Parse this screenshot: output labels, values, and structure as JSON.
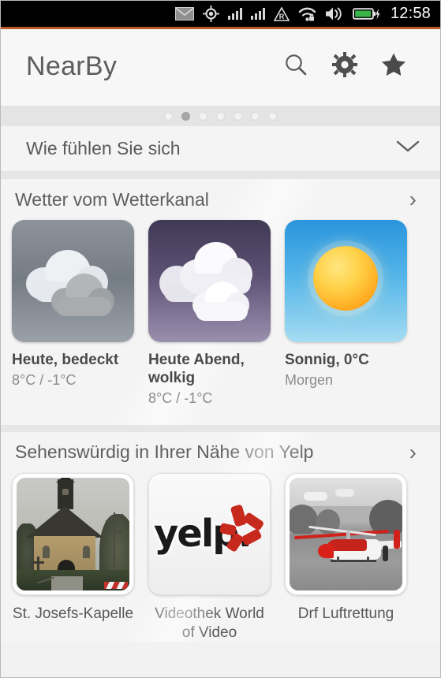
{
  "statusbar": {
    "icons": [
      "mail-icon",
      "location-icon",
      "cellular-signal-icon",
      "cellular-signal-2-icon",
      "roaming-icon",
      "wifi-secure-icon",
      "volume-icon",
      "battery-charging-icon"
    ],
    "clock": "12:58"
  },
  "header": {
    "title": "NearBy",
    "actions": [
      {
        "name": "search-icon",
        "label": "Suchen"
      },
      {
        "name": "gear-icon",
        "label": "Einstellungen"
      },
      {
        "name": "star-icon",
        "label": "Favoriten"
      }
    ]
  },
  "pager": {
    "count": 7,
    "active_index": 1
  },
  "mood": {
    "title": "Wie fühlen Sie sich",
    "chevron": "chevron-down-icon"
  },
  "sections": [
    {
      "id": "weather",
      "title": "Wetter vom Wetterkanal",
      "chevron": "›",
      "cards": [
        {
          "art": "overcast-clouds-art",
          "title": "Heute, bedeckt",
          "sub": "8°C / -1°C"
        },
        {
          "art": "cloudy-night-art",
          "title": "Heute Abend, wolkig",
          "sub": "8°C / -1°C"
        },
        {
          "art": "sunny-art",
          "title": "Sonnig, 0°C",
          "sub": "Morgen"
        }
      ]
    },
    {
      "id": "yelp",
      "title": "Sehenswürdig in Ihrer Nähe von Yelp",
      "chevron": "›",
      "cards": [
        {
          "art": "chapel-photo",
          "label": "St. Josefs-Kapelle"
        },
        {
          "art": "yelp-logo",
          "label": "Videothek World of Video"
        },
        {
          "art": "helicopter-photo",
          "label": "Drf Luftrettung"
        }
      ]
    }
  ],
  "colors": {
    "status_bar": "#000000",
    "accent_line": "#c0572c",
    "app_background": "#f4f4f4",
    "header_background": "#f7f7f7",
    "dots_background": "#e4e4e4",
    "title_text": "#5d5d5d",
    "card_title_text": "#4a4a4a",
    "card_sub_text": "#8c8c8c",
    "yelp_red": "#c8291d",
    "sun_yellow": "#ffd24a"
  }
}
